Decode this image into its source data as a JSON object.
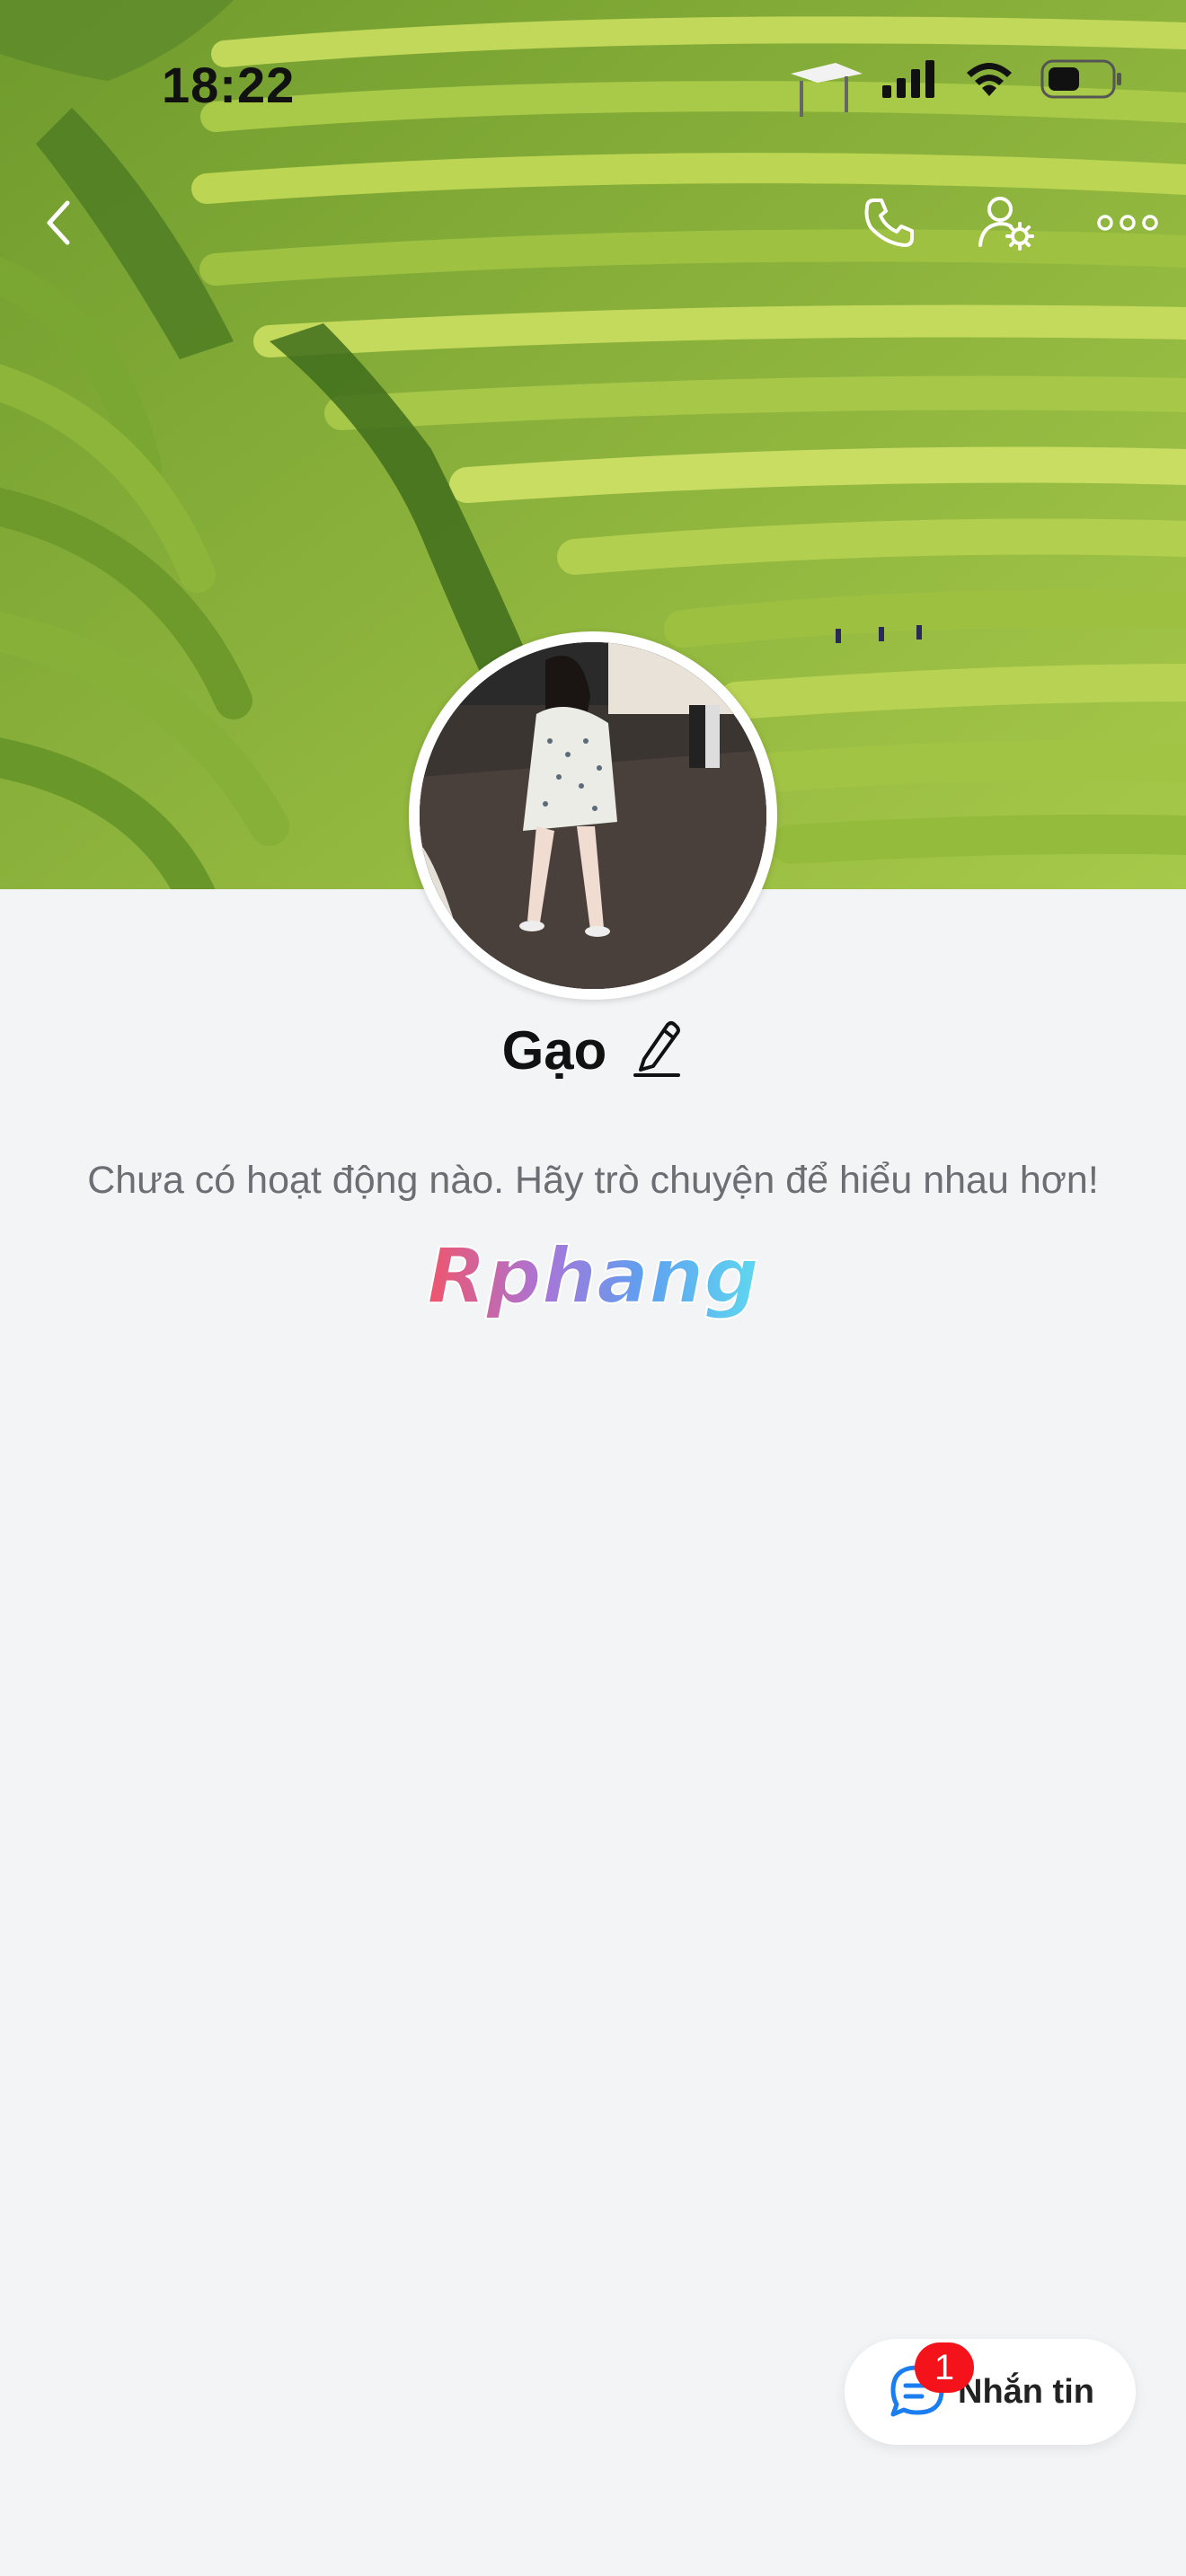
{
  "status_bar": {
    "time": "18:22",
    "icons": [
      "signal-icon",
      "wifi-icon",
      "battery-icon"
    ]
  },
  "nav": {
    "back_icon": "chevron-left-icon",
    "call_icon": "phone-icon",
    "settings_icon": "person-gear-icon",
    "more_icon": "more-dots-icon"
  },
  "profile": {
    "name": "Gạo",
    "edit_icon": "pencil-icon",
    "activity_text": "Chưa có hoạt động nào. Hãy trò chuyện để hiểu nhau hơn!"
  },
  "watermark": {
    "text": "Rphang"
  },
  "message_button": {
    "label": "Nhắn tin",
    "badge_count": "1",
    "icon": "chat-bubble-icon"
  },
  "colors": {
    "background": "#f3f4f6",
    "badge": "#f5131b",
    "accent_blue": "#1a7df0"
  }
}
